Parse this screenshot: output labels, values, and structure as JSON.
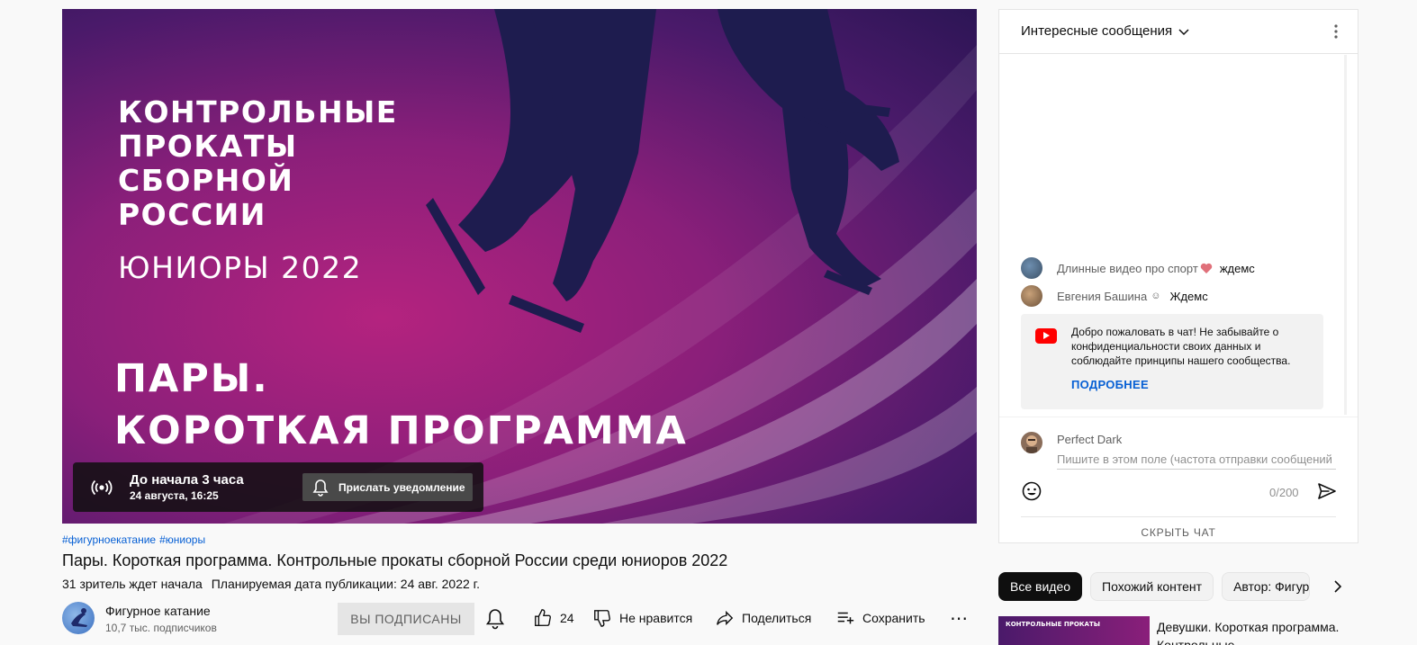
{
  "player": {
    "poster_title_lines": [
      "КОНТРОЛЬНЫЕ",
      "ПРОКАТЫ",
      "СБОРНОЙ",
      "РОССИИ"
    ],
    "poster_subtitle": "ЮНИОРЫ 2022",
    "poster_big_lines": [
      "ПАРЫ.",
      "КОРОТКАЯ ПРОГРАММА"
    ],
    "live": {
      "countdown": "До начала 3 часа",
      "datetime": "24 августа, 16:25",
      "notify_label": "Прислать уведомление"
    }
  },
  "video": {
    "hashtags": [
      "#фигурноекатание",
      "#юниоры"
    ],
    "title": "Пары. Короткая программа. Контрольные прокаты сборной России среди юниоров 2022",
    "waiting": "31 зритель ждет начала",
    "scheduled": "Планируемая дата публикации: 24 авг. 2022 г."
  },
  "owner": {
    "channel_name": "Фигурное катание",
    "subscribers": "10,7 тыс. подписчиков",
    "subscribed_label": "ВЫ ПОДПИСАНЫ"
  },
  "actions": {
    "like_count": "24",
    "dislike_label": "Не нравится",
    "share_label": "Поделиться",
    "save_label": "Сохранить"
  },
  "chat": {
    "mode_title": "Интересные сообщения",
    "messages": [
      {
        "author": "Длинные видео про спорт",
        "badge": "heart",
        "text": "ждемс"
      },
      {
        "author": "Евгения Башина",
        "badge": "smiley",
        "text": "Ждемс"
      }
    ],
    "welcome_text": "Добро пожаловать в чат! Не забывайте о конфиденциальности своих данных и соблюдайте принципы нашего сообщества.",
    "welcome_more": "ПОДРОБНЕЕ",
    "current_user": "Perfect Dark",
    "input_placeholder": "Пишите в этом поле (частота отправки сообщений ограничена)",
    "counter": "0/200",
    "hide_label": "СКРЫТЬ ЧАТ"
  },
  "chips": [
    "Все видео",
    "Похожий контент",
    "Автор: Фигурное катание"
  ],
  "recommended": [
    {
      "thumb_text": "КОНТРОЛЬНЫЕ ПРОКАТЫ",
      "title": "Девушки. Короткая программа. Контрольные"
    }
  ],
  "colors": {
    "accent_link": "#065fd4",
    "youtube_red": "#ff0000",
    "poster_magenta": "#b4237f",
    "poster_purple": "#4a1a6a"
  }
}
